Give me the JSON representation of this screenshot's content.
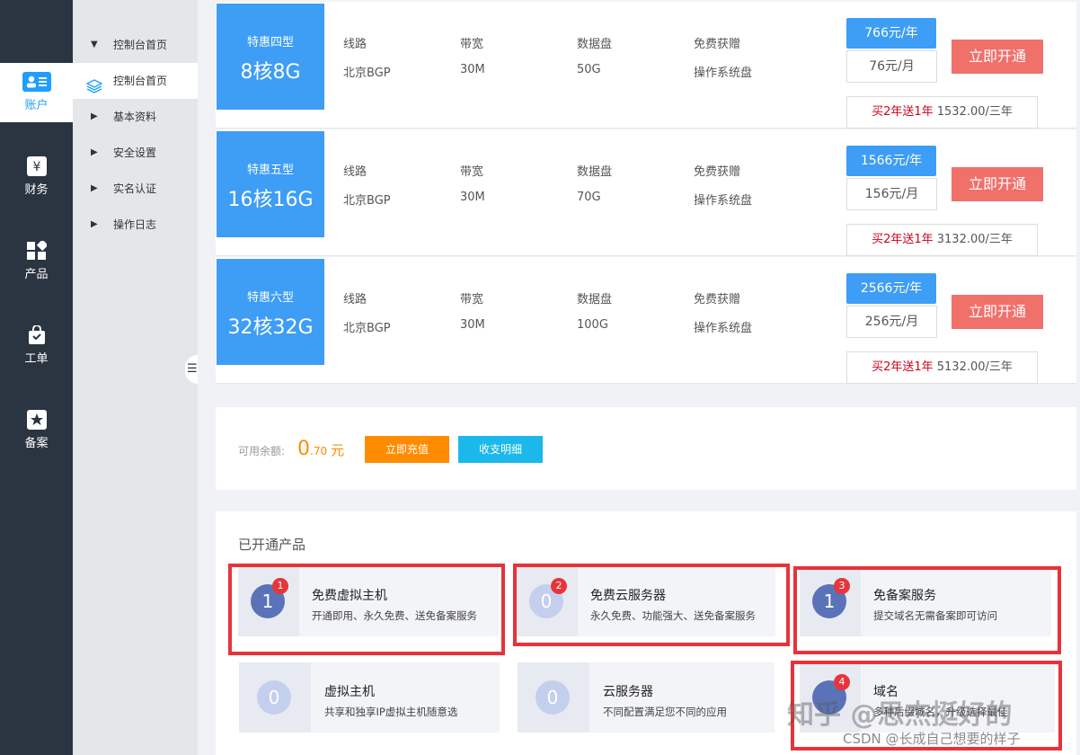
{
  "rail": {
    "items": [
      {
        "label": "账户",
        "active": true
      },
      {
        "label": "财务"
      },
      {
        "label": "产品"
      },
      {
        "label": "工单"
      },
      {
        "label": "备案"
      }
    ]
  },
  "subnav": {
    "items": [
      {
        "label": "控制台首页",
        "arrow": "▼"
      },
      {
        "label": "控制台首页",
        "active": true
      },
      {
        "label": "基本资料",
        "arrow": "▶"
      },
      {
        "label": "安全设置",
        "arrow": "▶"
      },
      {
        "label": "实名认证",
        "arrow": "▶"
      },
      {
        "label": "操作日志",
        "arrow": "▶"
      }
    ],
    "collapse_icon": "☰"
  },
  "plans": [
    {
      "tag": "特惠四型",
      "spec": "8核8G",
      "line_label": "线路",
      "line": "北京BGP",
      "bw_label": "带宽",
      "bw": "30M",
      "disk_label": "数据盘",
      "disk": "50G",
      "gift_label": "免费获赠",
      "gift": "操作系统盘",
      "year_price": "766元/年",
      "month_price": "76元/月",
      "buy": "立即开通",
      "promo_red": "买2年送1年",
      "promo_price": "1532.00/三年"
    },
    {
      "tag": "特惠五型",
      "spec": "16核16G",
      "line_label": "线路",
      "line": "北京BGP",
      "bw_label": "带宽",
      "bw": "30M",
      "disk_label": "数据盘",
      "disk": "70G",
      "gift_label": "免费获赠",
      "gift": "操作系统盘",
      "year_price": "1566元/年",
      "month_price": "156元/月",
      "buy": "立即开通",
      "promo_red": "买2年送1年",
      "promo_price": "3132.00/三年"
    },
    {
      "tag": "特惠六型",
      "spec": "32核32G",
      "line_label": "线路",
      "line": "北京BGP",
      "bw_label": "带宽",
      "bw": "30M",
      "disk_label": "数据盘",
      "disk": "100G",
      "gift_label": "免费获赠",
      "gift": "操作系统盘",
      "year_price": "2566元/年",
      "month_price": "256元/月",
      "buy": "立即开通",
      "promo_red": "买2年送1年",
      "promo_price": "5132.00/三年"
    }
  ],
  "balance": {
    "label": "可用余额:",
    "amount_int": "0",
    "amount_dec": ".70",
    "unit": "元",
    "recharge": "立即充值",
    "details": "收支明细"
  },
  "products": {
    "title": "已开通产品",
    "cards": [
      {
        "count": "1",
        "badge": "1",
        "name": "免费虚拟主机",
        "desc": "开通即用、永久免费、送免备案服务",
        "style": "dark"
      },
      {
        "count": "0",
        "badge": "2",
        "name": "免费云服务器",
        "desc": "永久免费、功能强大、送免备案服务",
        "style": "light"
      },
      {
        "count": "1",
        "badge": "3",
        "name": "免备案服务",
        "desc": "提交域名无需备案即可访问",
        "style": "dark"
      },
      {
        "count": "0",
        "badge": "",
        "name": "虚拟主机",
        "desc": "共享和独享IP虚拟主机随意选",
        "style": "light"
      },
      {
        "count": "0",
        "badge": "",
        "name": "云服务器",
        "desc": "不同配置满足您不同的应用",
        "style": "light"
      },
      {
        "count": "",
        "badge": "4",
        "name": "域名",
        "desc": "多种后缀域名，升级选择最佳",
        "style": "dark"
      }
    ]
  },
  "watermark": {
    "zhihu": "知乎 @思杰挺好的",
    "csdn": "CSDN @长成自己想要的样子"
  },
  "colors": {
    "accent": "#3e9df5",
    "danger": "#f0706a",
    "highlight": "#e8323a",
    "orange": "#ff8c00",
    "cyan": "#1bb8eb"
  }
}
